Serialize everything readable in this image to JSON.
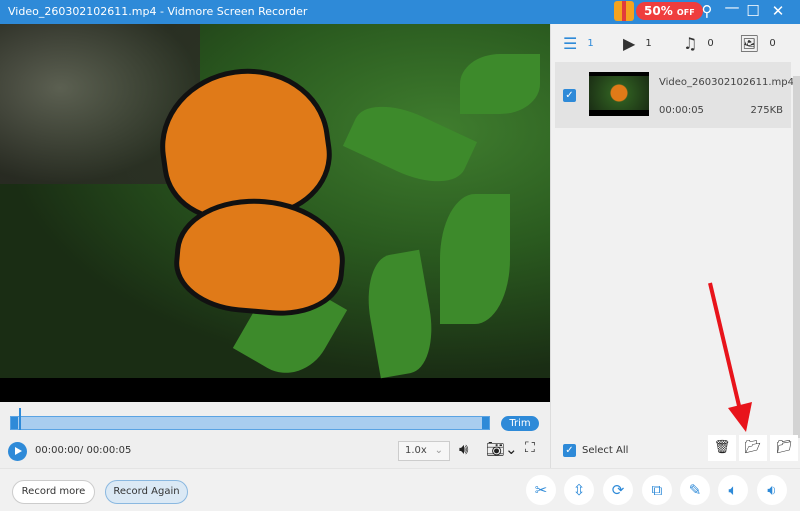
{
  "window": {
    "title": "Video_260302102611.mp4 - Vidmore Screen Recorder",
    "promo": "50%",
    "promo_suffix": "OFF"
  },
  "player": {
    "trim_label": "Trim",
    "time": "00:00:00/ 00:00:05",
    "speed": "1.0x",
    "progress": 0
  },
  "tabs": [
    {
      "icon": "list-icon",
      "count": "1"
    },
    {
      "icon": "video-icon",
      "count": "1"
    },
    {
      "icon": "music-icon",
      "count": "0"
    },
    {
      "icon": "image-icon",
      "count": "0"
    }
  ],
  "files": [
    {
      "name": "Video_260302102611.mp4",
      "duration": "00:00:05",
      "size": "275KB",
      "checked": true
    }
  ],
  "select_all": "Select All",
  "buttons": {
    "record_more": "Record more",
    "record_again": "Record Again"
  },
  "accent": "#2e8ad8"
}
